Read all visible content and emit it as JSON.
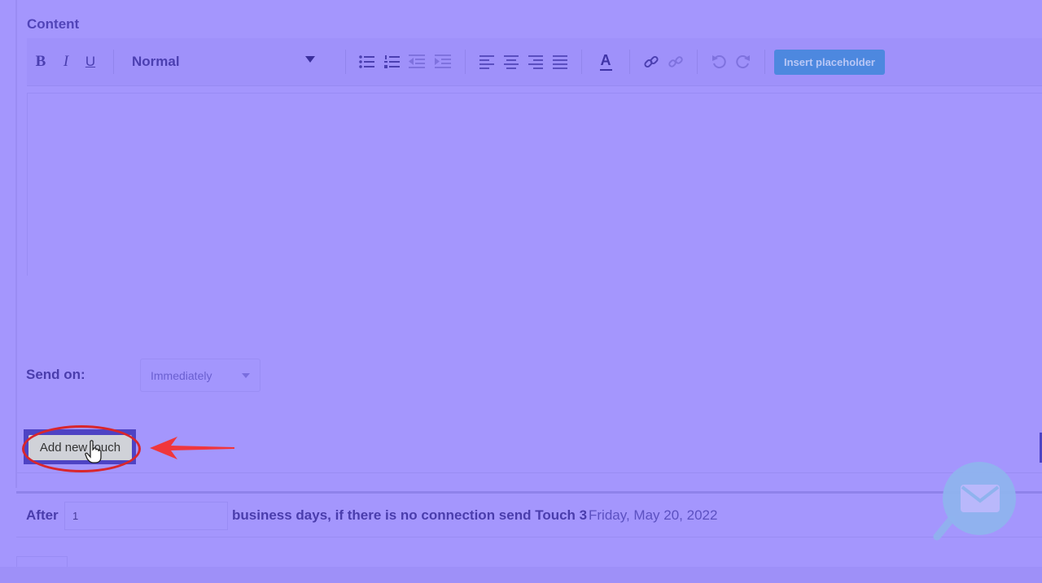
{
  "section": {
    "title": "Content"
  },
  "toolbar": {
    "bold_label": "B",
    "italic_label": "I",
    "underline_label": "U",
    "style_value": "Normal",
    "font_color_label": "A",
    "insert_placeholder_label": "Insert placeholder",
    "icons": [
      "bold-icon",
      "italic-icon",
      "underline-icon",
      "bulleted-list-icon",
      "numbered-list-icon",
      "outdent-icon",
      "indent-icon",
      "align-left-icon",
      "align-center-icon",
      "align-right-icon",
      "align-justify-icon",
      "font-color-icon",
      "link-icon",
      "unlink-icon",
      "undo-icon",
      "redo-icon"
    ]
  },
  "send": {
    "label": "Send on:",
    "value": "Immediately"
  },
  "add_touch": {
    "label": "Add new touch"
  },
  "after": {
    "label": "After",
    "days_value": "1",
    "text": "business days, if there is no connection send Touch 3",
    "date": "Friday, May 20, 2022"
  },
  "colors": {
    "background": "#a496fd",
    "accent_button": "#4d88df",
    "highlight_ring": "#d9262c",
    "mail_widget": "#8fb3ee"
  }
}
